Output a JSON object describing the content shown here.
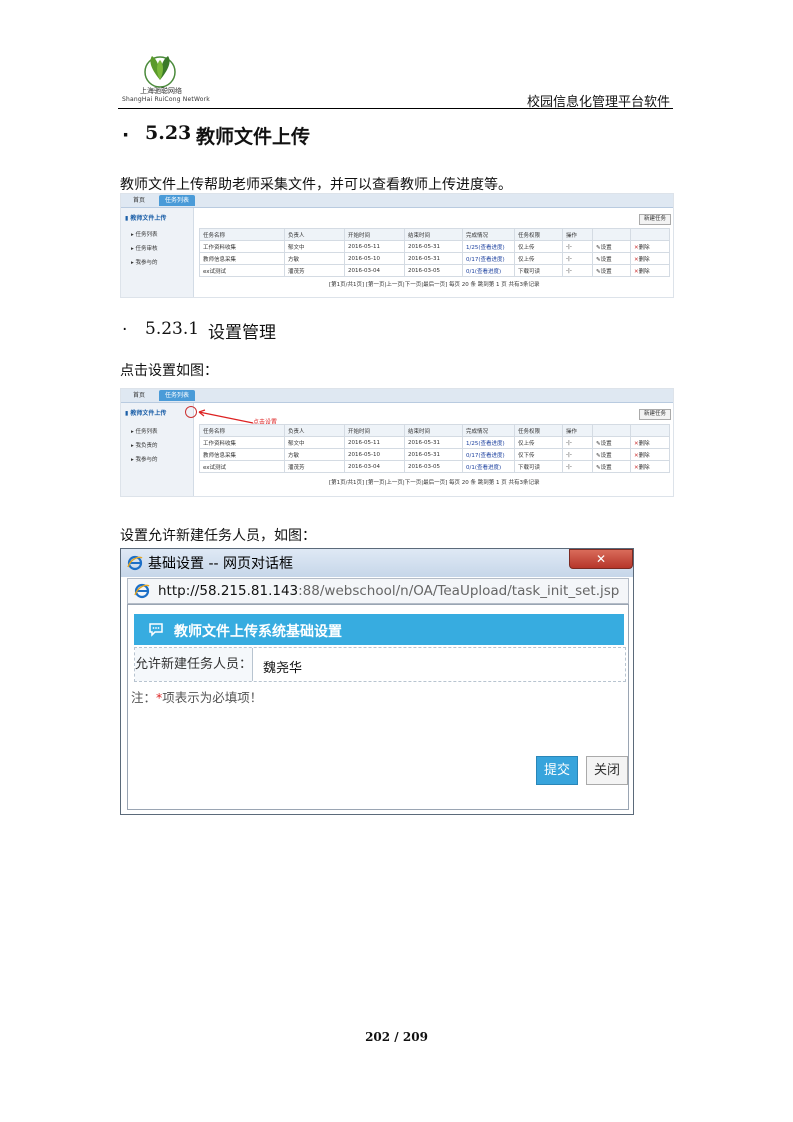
{
  "header": {
    "logo_cn": "上海驰聪网络",
    "logo_en": "ShangHai RuiCong NetWork",
    "doc_title": "校园信息化管理平台软件"
  },
  "section": {
    "bullet": "·",
    "number": "5.23",
    "title": "教师文件上传",
    "intro": "教师文件上传帮助老师采集文件，并可以查看教师上传进度等。"
  },
  "subsection": {
    "bullet": "·",
    "number": "5.23.1",
    "title": "设置管理",
    "p1": "点击设置如图：",
    "p2": "设置允许新建任务人员，如图："
  },
  "screenshot1": {
    "tab_home": "首页",
    "tab_active": "任务列表",
    "side_header": "教师文件上传",
    "side_items": [
      "任务列表",
      "任务审核",
      "我参与的"
    ],
    "new_button": "新建任务",
    "columns": [
      "任务名称",
      "负责人",
      "开始时间",
      "结束时间",
      "完成情况",
      "任务权限",
      "操作",
      "",
      ""
    ],
    "rows": [
      [
        "工作资料收集",
        "郁文中",
        "2016-05-11",
        "2016-05-31",
        "1/25(查看进度)",
        "仅上传",
        "-|-",
        "设置",
        "删除"
      ],
      [
        "教师信息采集",
        "方敏",
        "2016-05-10",
        "2016-05-31",
        "0/17(查看进度)",
        "仅上传",
        "-|-",
        "设置",
        "删除"
      ],
      [
        "ex试测试",
        "潘茂芳",
        "2016-03-04",
        "2016-03-05",
        "0/1(查看进度)",
        "下载可读",
        "-|-",
        "设置",
        "删除"
      ]
    ],
    "pager": "[第1页/共1页] [第一页|上一页|下一页|最后一页] 每页 20 条 跳到第 1 页 共有3条记录"
  },
  "screenshot2": {
    "tab_home": "首页",
    "tab_active": "任务列表",
    "side_header": "教师文件上传",
    "side_items": [
      "任务列表",
      "我负责的",
      "我参与的"
    ],
    "annotation": "点击设置",
    "new_button": "新建任务",
    "columns": [
      "任务名称",
      "负责人",
      "开始时间",
      "结束时间",
      "完成情况",
      "任务权限",
      "操作",
      "",
      ""
    ],
    "rows": [
      [
        "工作资料收集",
        "郁文中",
        "2016-05-11",
        "2016-05-31",
        "1/25(查看进度)",
        "仅上传",
        "-|-",
        "设置",
        "删除"
      ],
      [
        "教师信息采集",
        "方敏",
        "2016-05-10",
        "2016-05-31",
        "0/17(查看进度)",
        "仅下传",
        "-|-",
        "设置",
        "删除"
      ],
      [
        "ex试测试",
        "潘茂芳",
        "2016-03-04",
        "2016-03-05",
        "0/1(查看进度)",
        "下载可读",
        "-|-",
        "设置",
        "删除"
      ]
    ],
    "pager": "[第1页/共1页] [第一页|上一页|下一页|最后一页] 每页 20 条 跳到第 1 页 共有3条记录"
  },
  "dialog": {
    "window_title": "基础设置 -- 网页对话框",
    "close_glyph": "✕",
    "url_host": "http://58.215.81.143",
    "url_rest": ":88/webschool/n/OA/TeaUpload/task_init_set.jsp",
    "form_title": "教师文件上传系统基础设置",
    "field_label": "允许新建任务人员：",
    "field_value": "魏尧华",
    "note_prefix": "注：",
    "note_star": "*",
    "note_text": "项表示为必填项！",
    "submit_label": "提交",
    "close_label": "关闭"
  },
  "footer": {
    "page": "202 / 209"
  }
}
